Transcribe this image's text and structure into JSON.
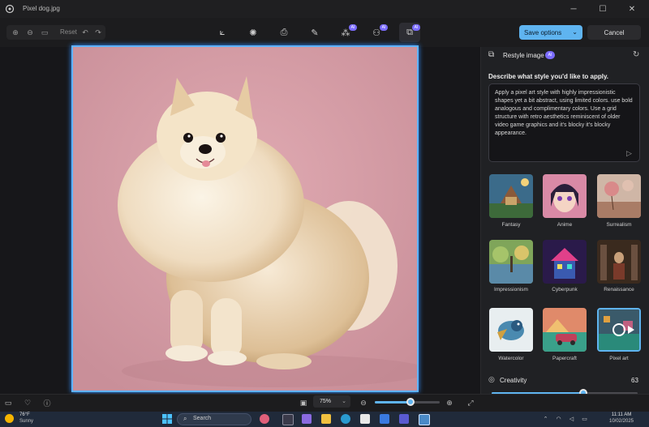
{
  "window": {
    "title": "Pixel dog.jpg"
  },
  "toolbar": {
    "reset_label": "Reset",
    "ai_badge": "AI"
  },
  "actions": {
    "save_label": "Save options",
    "cancel_label": "Cancel"
  },
  "panel": {
    "title": "Restyle image",
    "prompt_label": "Describe what style you'd like to apply.",
    "prompt_text": "Apply a pixel art style with highly impressionistic shapes yet a bit abstract, using limited colors. use bold analogous and complimentary colors. Use a grid structure with retro aesthetics reminiscent of older video game graphics and it's blocky it's blocky appearance.",
    "styles": [
      {
        "label": "Fantasy"
      },
      {
        "label": "Anime"
      },
      {
        "label": "Surrealism"
      },
      {
        "label": "Impressionism"
      },
      {
        "label": "Cyberpunk"
      },
      {
        "label": "Renaissance"
      },
      {
        "label": "Watercolor"
      },
      {
        "label": "Papercraft"
      },
      {
        "label": "Pixel art"
      }
    ],
    "selected_style": "Pixel art",
    "creativity": {
      "label": "Creativity",
      "value": 63,
      "max": 100
    }
  },
  "statusbar": {
    "zoom": "75%",
    "zoom_slider_fraction": 0.55
  },
  "taskbar": {
    "weather_temp": "76°F",
    "weather_cond": "Sunny",
    "search_label": "Search",
    "time": "11:11 AM",
    "date": "10/02/2025"
  },
  "colors": {
    "accent": "#5fb4f0",
    "ai_badge": "#7b6cff",
    "selection": "#5fb3ff"
  }
}
